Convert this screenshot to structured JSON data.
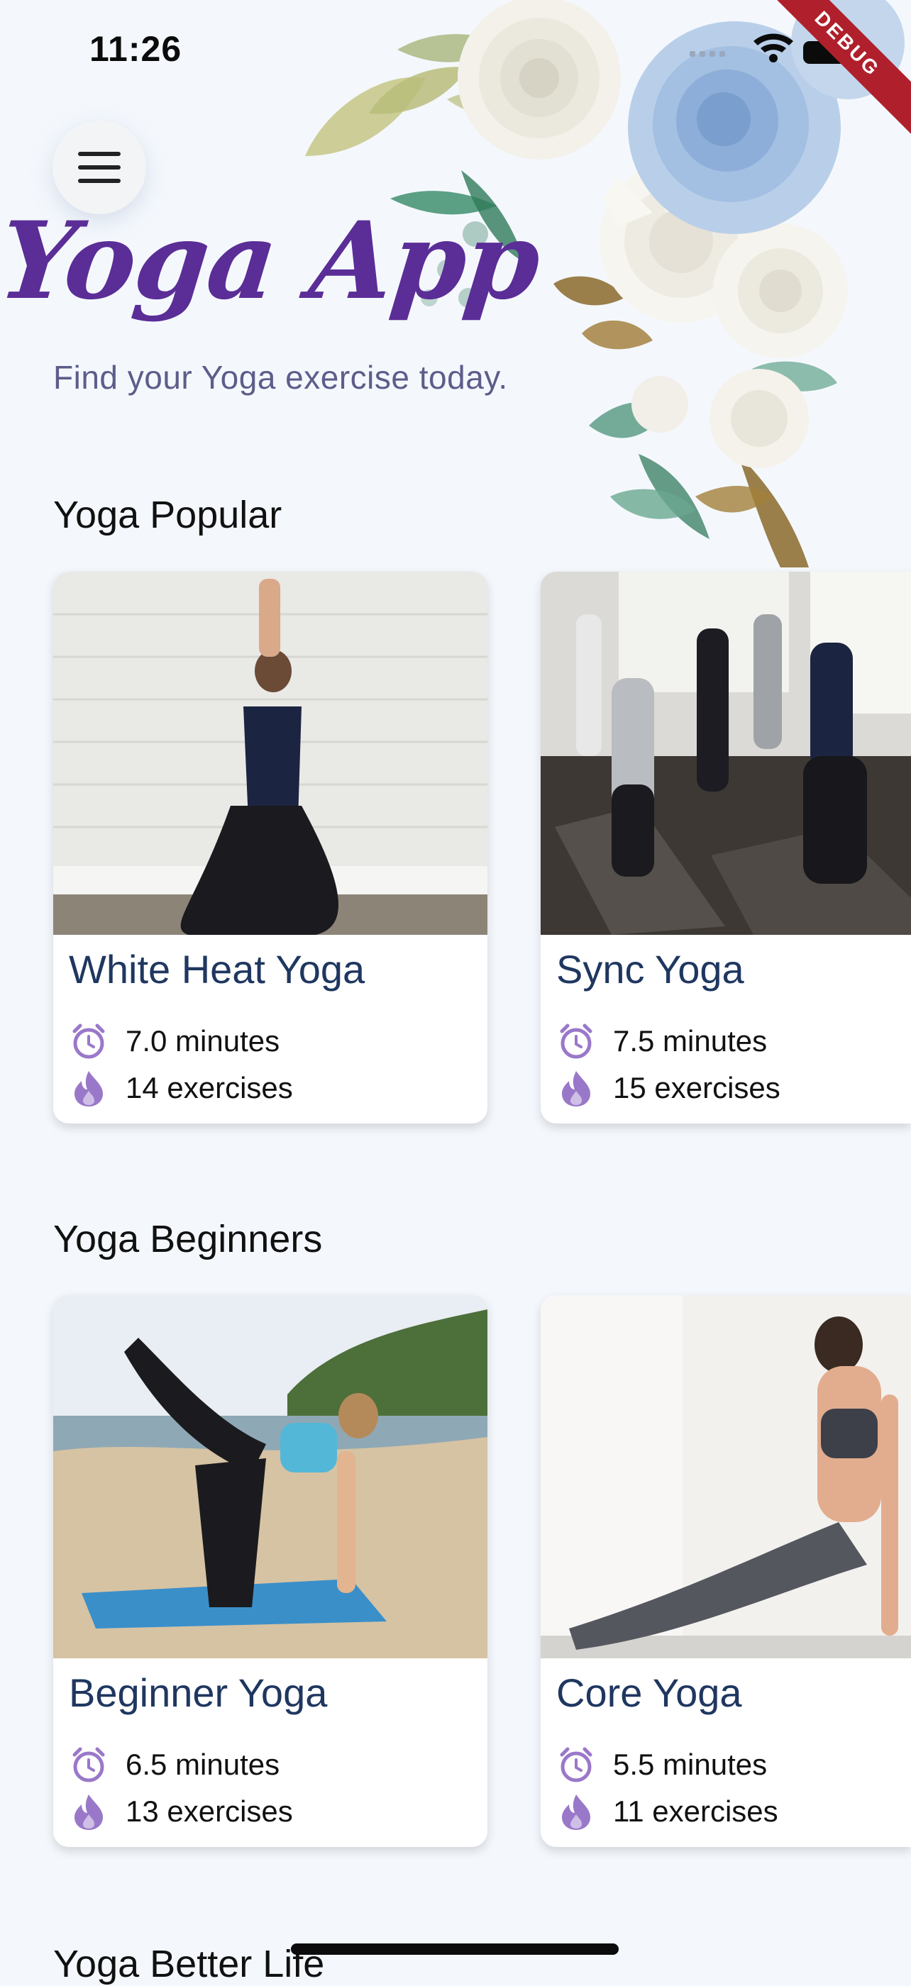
{
  "status_bar": {
    "time": "11:26"
  },
  "debug_banner": "DEBUG",
  "header": {
    "title": "Yoga App",
    "subtitle": "Find your Yoga exercise today."
  },
  "sections": [
    {
      "title": "Yoga Popular",
      "cards": [
        {
          "title": "White Heat Yoga",
          "duration": "7.0 minutes",
          "exercises": "14 exercises"
        },
        {
          "title": "Sync Yoga",
          "duration": "7.5 minutes",
          "exercises": "15 exercises"
        }
      ]
    },
    {
      "title": "Yoga Beginners",
      "cards": [
        {
          "title": "Beginner Yoga",
          "duration": "6.5 minutes",
          "exercises": "13 exercises"
        },
        {
          "title": "Core Yoga",
          "duration": "5.5 minutes",
          "exercises": "11 exercises"
        }
      ]
    },
    {
      "title": "Yoga Better Life"
    }
  ],
  "icons": {
    "menu": "hamburger-icon",
    "duration": "alarm-clock-icon",
    "exercises": "flame-icon"
  },
  "colors": {
    "background": "#f4f8fd",
    "title_purple": "#5b2d97",
    "card_title": "#1f3760",
    "icon_purple": "#9a78c9",
    "debug_red": "#b0202c"
  }
}
